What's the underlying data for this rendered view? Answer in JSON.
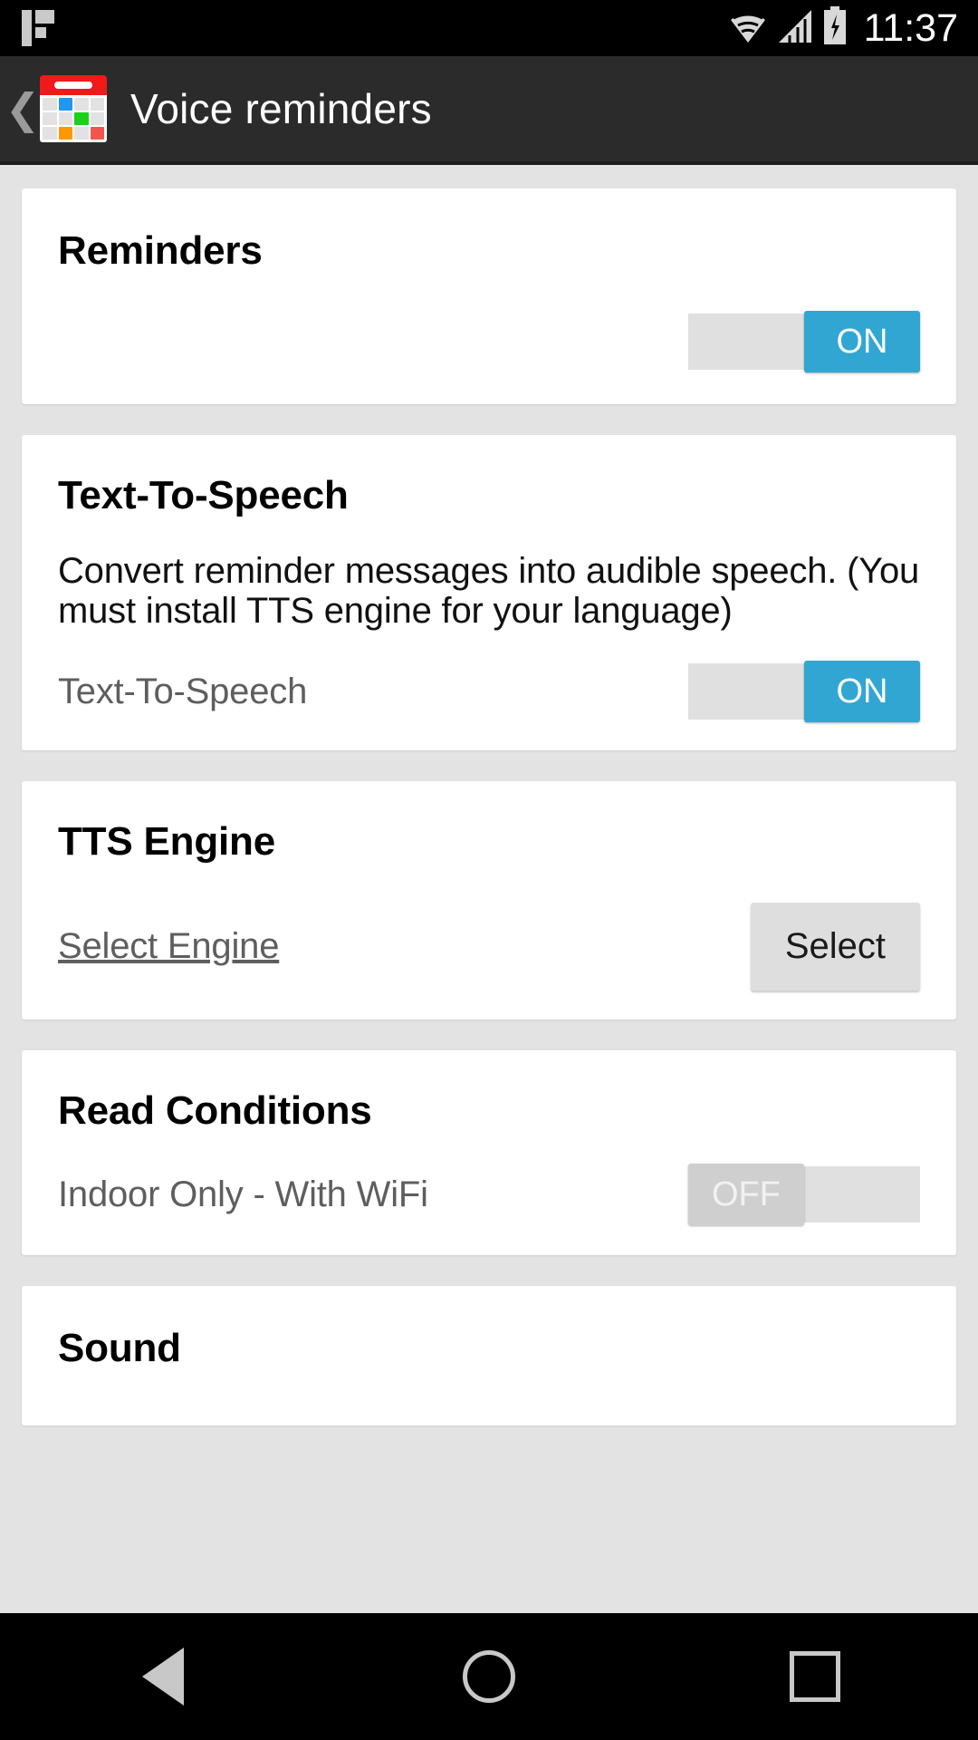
{
  "status_bar": {
    "clock": "11:37",
    "notification_icon": "app-notification-icon",
    "wifi_icon": "wifi-icon",
    "signal_icon": "cellular-signal-icon",
    "battery_icon": "battery-charging-icon",
    "background": "#000000"
  },
  "action_bar": {
    "back_label": "❮",
    "app_icon": "calendar-icon",
    "title": "Voice reminders",
    "background": "#2b2b2b"
  },
  "theme": {
    "page_background": "#e3e3e3",
    "card_background": "#ffffff",
    "accent_on": "#32a6d2",
    "toggle_track": "#e0e0e0",
    "toggle_off_thumb": "#cfcfcf",
    "button_background": "#dedede"
  },
  "cards": [
    {
      "id": "reminders",
      "title": "Reminders",
      "toggle": {
        "state": "ON",
        "label": "ON"
      }
    },
    {
      "id": "text-to-speech",
      "title": "Text-To-Speech",
      "description": "Convert reminder messages into audible speech. (You must install TTS engine for your language)",
      "row_label": "Text-To-Speech",
      "toggle": {
        "state": "ON",
        "label": "ON"
      }
    },
    {
      "id": "tts-engine",
      "title": "TTS Engine",
      "link_label": "Select Engine",
      "button_label": "Select"
    },
    {
      "id": "read-conditions",
      "title": "Read Conditions",
      "row_label": "Indoor Only - With WiFi",
      "toggle": {
        "state": "OFF",
        "label": "OFF"
      }
    },
    {
      "id": "sound",
      "title": "Sound"
    }
  ],
  "nav_bar": {
    "back": "back-triangle-icon",
    "home": "home-circle-icon",
    "recents": "recents-square-icon",
    "background": "#000000"
  }
}
